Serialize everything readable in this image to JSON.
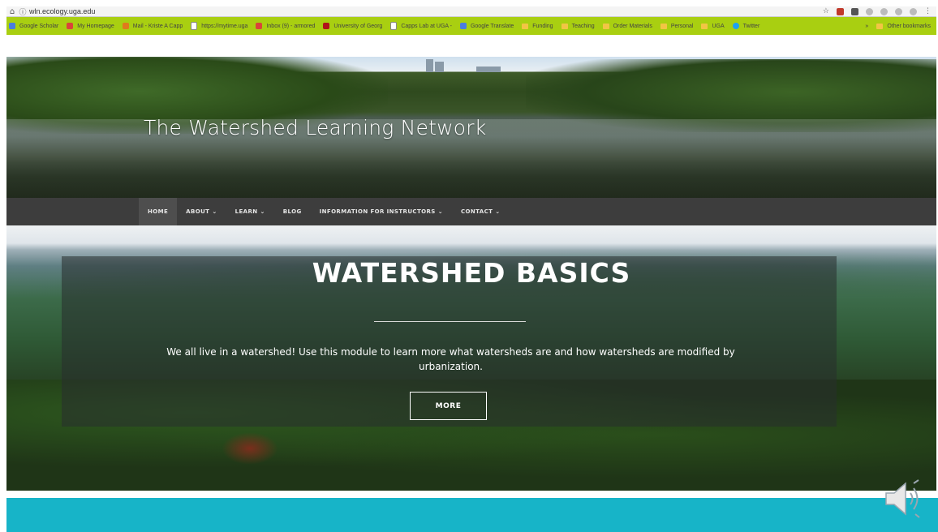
{
  "browser": {
    "url": "wln.ecology.uga.edu",
    "bookmarks": [
      {
        "label": "Google Scholar",
        "icon": "google-scholar-icon",
        "color": "#4a7de0"
      },
      {
        "label": "My Homepage",
        "icon": "homepage-icon",
        "color": "#d9453a"
      },
      {
        "label": "Mail - Kriste A Capp",
        "icon": "mail-icon",
        "color": "#e07a1c"
      },
      {
        "label": "https://mytime.uga",
        "icon": "page-icon",
        "color": "#ffffff"
      },
      {
        "label": "Inbox (9) - armored",
        "icon": "gmail-icon",
        "color": "#d9453a"
      },
      {
        "label": "University of Georg",
        "icon": "uga-icon",
        "color": "#b0141a"
      },
      {
        "label": "Capps Lab at UGA -",
        "icon": "page-icon",
        "color": "#ffffff"
      },
      {
        "label": "Google Translate",
        "icon": "translate-icon",
        "color": "#4a7de0"
      },
      {
        "label": "Funding",
        "icon": "folder-icon"
      },
      {
        "label": "Teaching",
        "icon": "folder-icon"
      },
      {
        "label": "Order Materials",
        "icon": "folder-icon"
      },
      {
        "label": "Personal",
        "icon": "folder-icon"
      },
      {
        "label": "UGA",
        "icon": "folder-icon"
      },
      {
        "label": "Twitter",
        "icon": "twitter-icon",
        "color": "#1da1f2"
      }
    ],
    "overflow_label": "»",
    "other_bookmarks": "Other bookmarks"
  },
  "site": {
    "title": "The Watershed Learning Network",
    "nav": [
      {
        "label": "HOME",
        "caret": false,
        "active": true
      },
      {
        "label": "ABOUT",
        "caret": true
      },
      {
        "label": "LEARN",
        "caret": true
      },
      {
        "label": "BLOG",
        "caret": false
      },
      {
        "label": "INFORMATION FOR INSTRUCTORS",
        "caret": true
      },
      {
        "label": "CONTACT",
        "caret": true
      }
    ],
    "banner": {
      "heading": "WATERSHED BASICS",
      "description": "We all live in a watershed! Use this module to learn more what watersheds are and how watersheds are modified by urbanization.",
      "button": "MORE"
    }
  },
  "colors": {
    "bookmark_bar": "#a9cf11",
    "nav_bg": "#3d3d3d",
    "footer": "#17b4c8"
  }
}
